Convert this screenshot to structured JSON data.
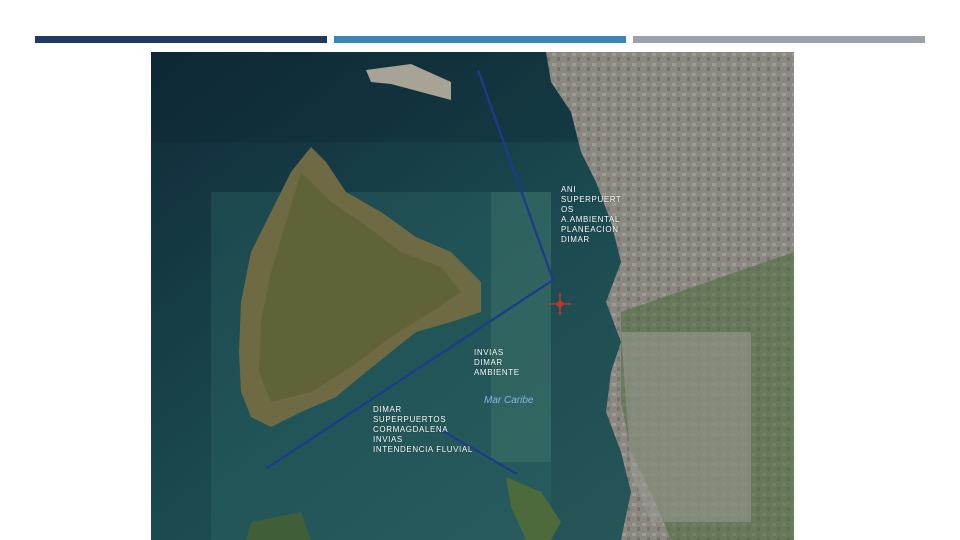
{
  "colors": {
    "bar_left": "#1f3864",
    "bar_middle": "#3a87b5",
    "bar_right": "#9ba2ab",
    "route_line": "#1e3a8a",
    "marker": "#c0392b"
  },
  "map": {
    "sea_label": "Mar Caribe",
    "labels": {
      "north_channel": "ANI\nSUPERPUERT\nOS\nA.AMBIENTAL\nPLANEACION\nDIMAR",
      "central_bay": "INVIAS\nDIMAR\nAMBIENTE",
      "south_channel": "DIMAR\nSUPERPUERTOS\nCORMAGDALENA\nINVIAS\nINTENDENCIA FLUVIAL"
    },
    "marker_icon": "crosshair-marker-icon"
  }
}
